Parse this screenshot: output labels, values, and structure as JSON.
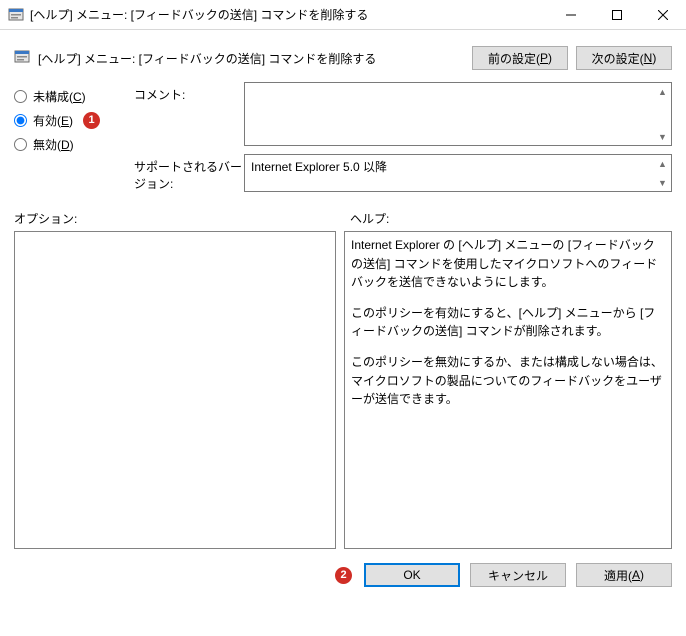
{
  "window": {
    "title": "[ヘルプ] メニュー: [フィードバックの送信] コマンドを削除する"
  },
  "header": {
    "title": "[ヘルプ] メニュー: [フィードバックの送信] コマンドを削除する",
    "prev_label_pre": "前の設定(",
    "prev_accel": "P",
    "prev_label_post": ")",
    "next_label_pre": "次の設定(",
    "next_accel": "N",
    "next_label_post": ")"
  },
  "radios": {
    "not_configured_pre": "未構成(",
    "not_configured_accel": "C",
    "not_configured_post": ")",
    "enabled_pre": "有効(",
    "enabled_accel": "E",
    "enabled_post": ")",
    "disabled_pre": "無効(",
    "disabled_accel": "D",
    "disabled_post": ")",
    "selected": "enabled"
  },
  "annotations": {
    "step1": "1",
    "step2": "2"
  },
  "fields": {
    "comment_label": "コメント:",
    "comment_value": "",
    "supported_label": "サポートされるバージョン:",
    "supported_value": "Internet Explorer 5.0 以降"
  },
  "section_labels": {
    "options": "オプション:",
    "help": "ヘルプ:"
  },
  "help_text": {
    "p1": "Internet Explorer の [ヘルプ] メニューの [フィードバックの送信] コマンドを使用したマイクロソフトへのフィードバックを送信できないようにします。",
    "p2": "このポリシーを有効にすると、[ヘルプ] メニューから [フィードバックの送信] コマンドが削除されます。",
    "p3": "このポリシーを無効にするか、または構成しない場合は、マイクロソフトの製品についてのフィードバックをユーザーが送信できます。"
  },
  "buttons": {
    "ok": "OK",
    "cancel": "キャンセル",
    "apply_pre": "適用(",
    "apply_accel": "A",
    "apply_post": ")"
  }
}
